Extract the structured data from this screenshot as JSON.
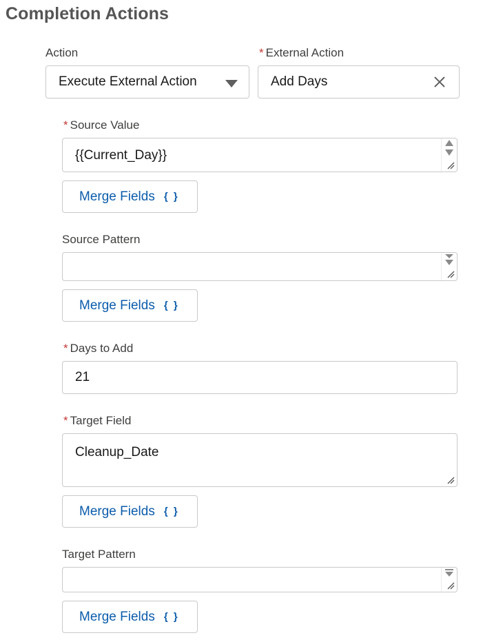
{
  "section": {
    "title": "Completion Actions"
  },
  "action": {
    "label": "Action",
    "value": "Execute External Action",
    "icon": "chevron-down-icon"
  },
  "external_action": {
    "label": "External Action",
    "required_mark": "*",
    "value": "Add Days",
    "clear_icon": "close-icon"
  },
  "source_value": {
    "label": "Source Value",
    "required_mark": "*",
    "value": "{{Current_Day}}"
  },
  "source_pattern": {
    "label": "Source Pattern",
    "value": ""
  },
  "days_to_add": {
    "label": "Days to Add",
    "required_mark": "*",
    "value": "21"
  },
  "target_field": {
    "label": "Target Field",
    "required_mark": "*",
    "value": "Cleanup_Date"
  },
  "target_pattern": {
    "label": "Target Pattern",
    "value": ""
  },
  "merge_fields": {
    "label": "Merge Fields",
    "icon_text": "{ }"
  },
  "colors": {
    "required": "#c23934",
    "link": "#0b5cab",
    "border": "#c9c9c9",
    "title": "#555555"
  }
}
